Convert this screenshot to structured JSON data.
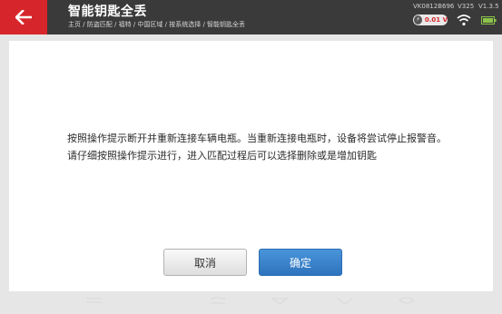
{
  "header": {
    "back_icon": "arrow-left-icon",
    "title": "智能钥匙全丢",
    "breadcrumb": "主页 / 防盗匹配 / 福特 / 中国区域 / 按系统选择 / 智能钥匙全丢",
    "serial": "VK0812B696",
    "version_primary": "V325",
    "version_secondary": "V1.3.5",
    "voltage": "0.01 V",
    "voltage_color": "#d7262b",
    "accent_color": "#d7262b"
  },
  "dialog": {
    "message": "按照操作提示断开并重新连接车辆电瓶。当重新连接电瓶时，设备将尝试停止报警音。请仔细按照操作提示进行，进入匹配过程后可以选择删除或是增加钥匙",
    "cancel_label": "取消",
    "confirm_label": "确定",
    "confirm_color": "#2d73be"
  }
}
